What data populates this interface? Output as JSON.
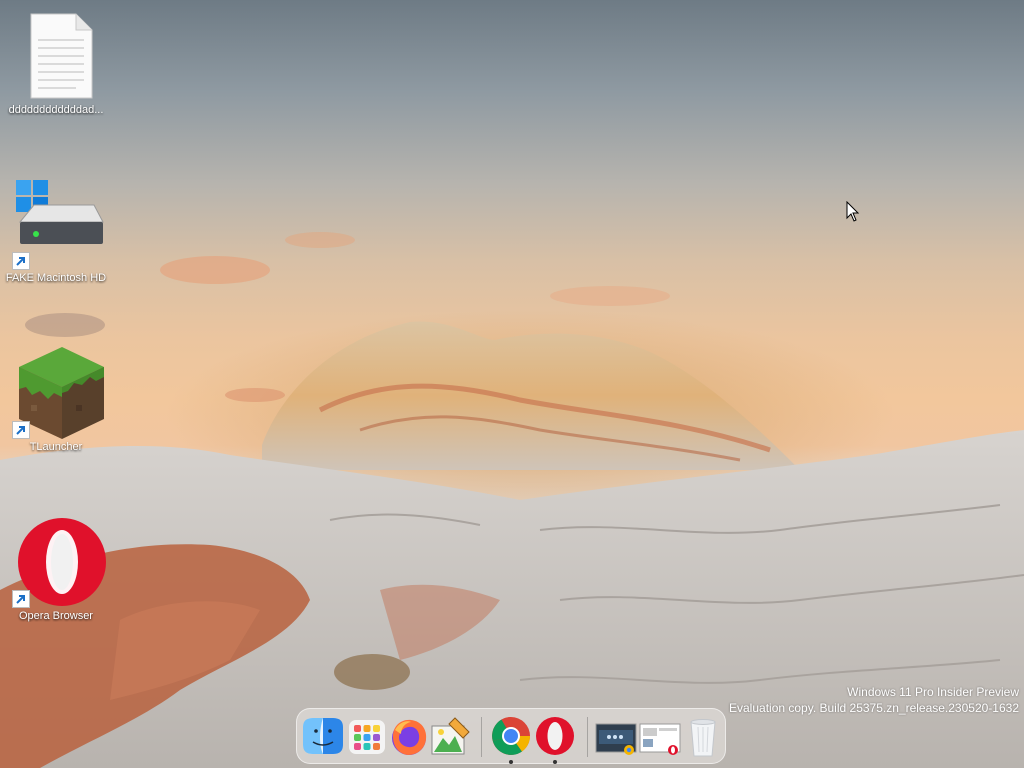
{
  "desktop": {
    "icons": [
      {
        "label": "ddddddddddddad...",
        "icon": "text-file-icon",
        "shortcut": false
      },
      {
        "label": "FAKE Macintosh HD",
        "icon": "hard-drive-icon",
        "shortcut": true
      },
      {
        "label": "TLauncher",
        "icon": "minecraft-grass-block-icon",
        "shortcut": true
      },
      {
        "label": "Opera Browser",
        "icon": "opera-icon",
        "shortcut": true
      }
    ]
  },
  "watermark": {
    "line1": "Windows 11 Pro Insider Preview",
    "line2": "Evaluation copy. Build 25375.zn_release.230520-1632"
  },
  "dock": {
    "apps": [
      {
        "name": "Finder",
        "icon": "finder-icon",
        "running": false
      },
      {
        "name": "Launchpad",
        "icon": "launchpad-icon",
        "running": false
      },
      {
        "name": "Firefox",
        "icon": "firefox-icon",
        "running": false
      },
      {
        "name": "Image Editor",
        "icon": "image-editor-icon",
        "running": false
      },
      {
        "name": "Google Chrome",
        "icon": "chrome-icon",
        "running": true
      },
      {
        "name": "Opera",
        "icon": "opera-icon",
        "running": true
      },
      {
        "name": "Chrome window",
        "icon": "window-thumbnail-chrome",
        "running": false
      },
      {
        "name": "Opera window",
        "icon": "window-thumbnail-opera",
        "running": false
      },
      {
        "name": "Trash",
        "icon": "trash-icon",
        "running": false
      }
    ]
  }
}
